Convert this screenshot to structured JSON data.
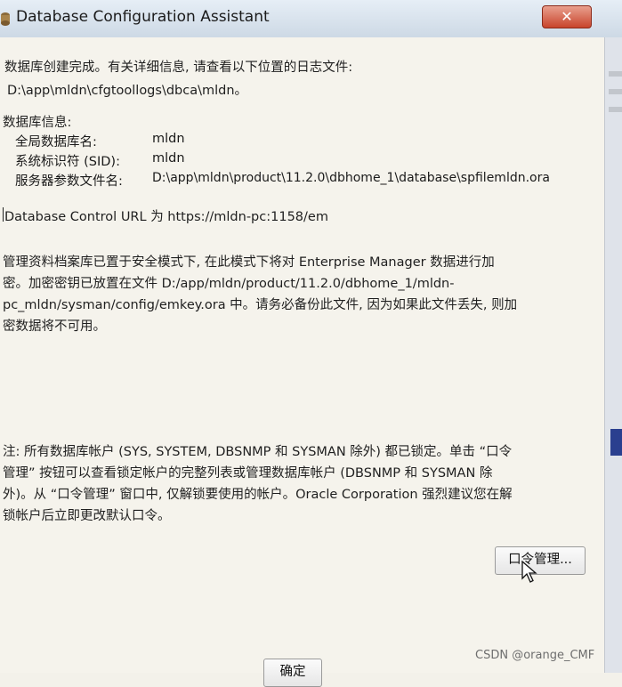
{
  "window": {
    "title": "Database Configuration Assistant",
    "close_label": "✕"
  },
  "content": {
    "completion_line": "数据库创建完成。有关详细信息, 请查看以下位置的日志文件:",
    "log_path": "D:\\app\\mldn\\cfgtoollogs\\dbca\\mldn。",
    "db_info_heading": "数据库信息:",
    "db_info": [
      {
        "label": "全局数据库名:",
        "value": "mldn"
      },
      {
        "label": "系统标识符 (SID):",
        "value": "mldn"
      },
      {
        "label": "服务器参数文件名:",
        "value": "D:\\app\\mldn\\product\\11.2.0\\dbhome_1\\database\\spfilemldn.ora"
      }
    ],
    "control_url_line": "Database Control URL 为 https://mldn-pc:1158/em",
    "security_paragraph": [
      "管理资料档案库已置于安全模式下, 在此模式下将对 Enterprise Manager 数据进行加",
      "密。加密密钥已放置在文件 D:/app/mldn/product/11.2.0/dbhome_1/mldn-",
      "pc_mldn/sysman/config/emkey.ora 中。请务必备份此文件, 因为如果此文件丢失, 则加",
      "密数据将不可用。"
    ],
    "note_paragraph": [
      "注: 所有数据库帐户 (SYS, SYSTEM, DBSNMP 和 SYSMAN 除外) 都已锁定。单击 “口令",
      "管理” 按钮可以查看锁定帐户的完整列表或管理数据库帐户 (DBSNMP 和 SYSMAN 除",
      "外)。从 “口令管理” 窗口中, 仅解锁要使用的帐户。Oracle Corporation 强烈建议您在解",
      "锁帐户后立即更改默认口令。"
    ]
  },
  "buttons": {
    "password_management": "口令管理...",
    "ok": "确定"
  },
  "watermark": "CSDN @orange_CMF",
  "colors": {
    "dialog_bg": "#f5f3ec",
    "titlebar": "#d6e0ea",
    "close_button": "#c8442c"
  }
}
